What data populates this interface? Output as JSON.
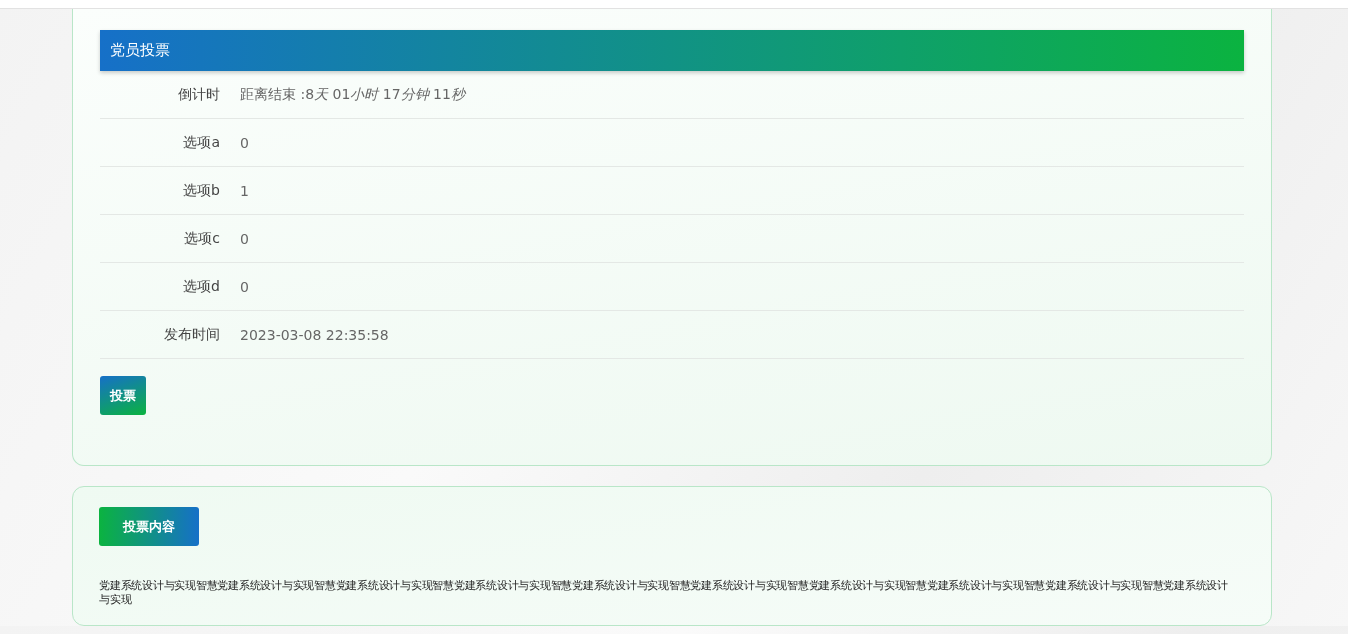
{
  "vote_panel": {
    "title": "党员投票",
    "rows": [
      {
        "label": "倒计时",
        "value_parts": [
          {
            "text": "距离结束 :8",
            "italic": false
          },
          {
            "text": "天",
            "italic": true
          },
          {
            "text": " 01",
            "italic": false
          },
          {
            "text": "小时",
            "italic": true
          },
          {
            "text": " 17",
            "italic": false
          },
          {
            "text": "分钟",
            "italic": true
          },
          {
            "text": " 11",
            "italic": false
          },
          {
            "text": "秒",
            "italic": true
          }
        ]
      },
      {
        "label": "选项a",
        "value": "0"
      },
      {
        "label": "选项b",
        "value": "1"
      },
      {
        "label": "选项c",
        "value": "0"
      },
      {
        "label": "选项d",
        "value": "0"
      },
      {
        "label": "发布时间",
        "value": "2023-03-08 22:35:58"
      }
    ],
    "vote_button": "投票"
  },
  "content_panel": {
    "heading": "投票内容",
    "text": "党建系统设计与实现智慧党建系统设计与实现智慧党建系统设计与实现智慧党建系统设计与实现智慧党建系统设计与实现智慧党建系统设计与实现智慧党建系统设计与实现智慧党建系统设计与实现智慧党建系统设计与实现智慧党建系统设计与实现"
  }
}
